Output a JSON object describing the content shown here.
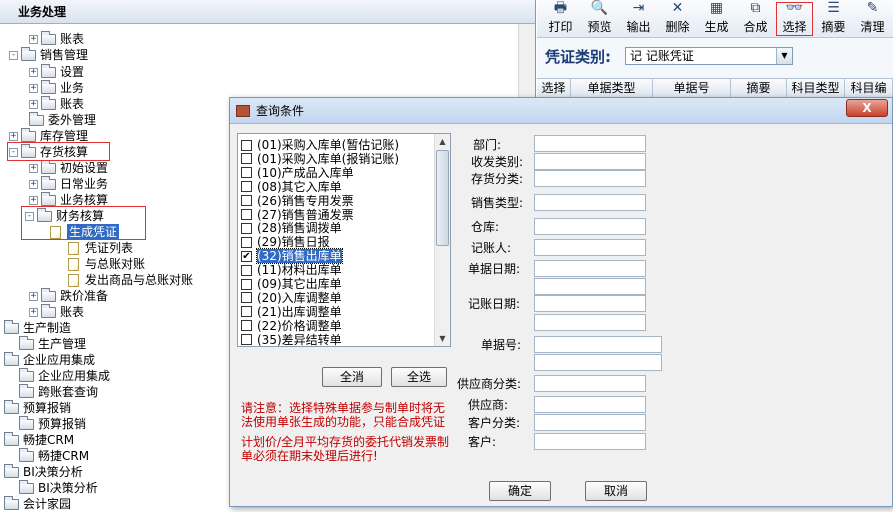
{
  "left_panel": {
    "title": "业务处理",
    "tree": [
      {
        "label": "账表",
        "expander": "+",
        "icon": "folder"
      },
      {
        "label": "销售管理",
        "expander": "-",
        "icon": "folder"
      },
      {
        "label": "设置",
        "expander": "+",
        "icon": "folder"
      },
      {
        "label": "业务",
        "expander": "+",
        "icon": "folder"
      },
      {
        "label": "账表",
        "expander": "+",
        "icon": "folder"
      },
      {
        "label": "委外管理",
        "expander": "",
        "icon": "folder"
      },
      {
        "label": "库存管理",
        "expander": "+",
        "icon": "folder"
      },
      {
        "label": "存货核算",
        "expander": "-",
        "icon": "folder"
      },
      {
        "label": "初始设置",
        "expander": "+",
        "icon": "folder"
      },
      {
        "label": "日常业务",
        "expander": "+",
        "icon": "folder"
      },
      {
        "label": "业务核算",
        "expander": "+",
        "icon": "folder"
      },
      {
        "label": "财务核算",
        "expander": "-",
        "icon": "folder"
      },
      {
        "label": "生成凭证",
        "expander": "",
        "icon": "doc"
      },
      {
        "label": "凭证列表",
        "expander": "",
        "icon": "doc"
      },
      {
        "label": "与总账对账",
        "expander": "",
        "icon": "doc"
      },
      {
        "label": "发出商品与总账对账",
        "expander": "",
        "icon": "doc"
      },
      {
        "label": "跌价准备",
        "expander": "+",
        "icon": "folder"
      },
      {
        "label": "账表",
        "expander": "+",
        "icon": "folder"
      },
      {
        "label": "生产制造",
        "expander": "",
        "icon": "folder"
      },
      {
        "label": "生产管理",
        "expander": "",
        "icon": "folder"
      },
      {
        "label": "企业应用集成",
        "expander": "",
        "icon": "folder"
      },
      {
        "label": "企业应用集成",
        "expander": "",
        "icon": "folder"
      },
      {
        "label": "跨账套查询",
        "expander": "",
        "icon": "folder"
      },
      {
        "label": "预算报销",
        "expander": "",
        "icon": "folder"
      },
      {
        "label": "预算报销",
        "expander": "",
        "icon": "folder"
      },
      {
        "label": "畅捷CRM",
        "expander": "",
        "icon": "folder"
      },
      {
        "label": "畅捷CRM",
        "expander": "",
        "icon": "folder"
      },
      {
        "label": "BI决策分析",
        "expander": "",
        "icon": "folder"
      },
      {
        "label": "BI决策分析",
        "expander": "",
        "icon": "folder"
      },
      {
        "label": "会计家园",
        "expander": "",
        "icon": "folder"
      }
    ]
  },
  "toolbar": {
    "buttons": [
      {
        "label": "打印",
        "icon": "printer-icon",
        "glyph": "🖶"
      },
      {
        "label": "预览",
        "icon": "preview-icon",
        "glyph": "🔍"
      },
      {
        "label": "输出",
        "icon": "export-icon",
        "glyph": "⇥"
      },
      {
        "label": "删除",
        "icon": "delete-icon",
        "glyph": "✕"
      },
      {
        "label": "生成",
        "icon": "generate-icon",
        "glyph": "▦"
      },
      {
        "label": "合成",
        "icon": "combine-icon",
        "glyph": "⧉"
      },
      {
        "label": "选择",
        "icon": "binoculars-icon",
        "glyph": "👓"
      },
      {
        "label": "摘要",
        "icon": "summary-icon",
        "glyph": "☰"
      },
      {
        "label": "清理",
        "icon": "clear-icon",
        "glyph": "✎"
      }
    ]
  },
  "voucher": {
    "label": "凭证类别:",
    "value": "记 记账凭证"
  },
  "grid": {
    "headers": [
      "选择",
      "单据类型",
      "单据号",
      "摘要",
      "科目类型",
      "科目编"
    ]
  },
  "dialog": {
    "title": "查询条件",
    "close_label": "X",
    "doc_types": [
      {
        "label": "(01)采购入库单(暂估记账)",
        "checked": false
      },
      {
        "label": "(01)采购入库单(报销记账)",
        "checked": false
      },
      {
        "label": "(10)产成品入库单",
        "checked": false
      },
      {
        "label": "(08)其它入库单",
        "checked": false
      },
      {
        "label": "(26)销售专用发票",
        "checked": false
      },
      {
        "label": "(27)销售普通发票",
        "checked": false
      },
      {
        "label": "(28)销售调拨单",
        "checked": false
      },
      {
        "label": "(29)销售日报",
        "checked": false
      },
      {
        "label": "(32)销售出库单",
        "checked": true
      },
      {
        "label": "(11)材料出库单",
        "checked": false
      },
      {
        "label": "(09)其它出库单",
        "checked": false
      },
      {
        "label": "(20)入库调整单",
        "checked": false
      },
      {
        "label": "(21)出库调整单",
        "checked": false
      },
      {
        "label": "(22)价格调整单",
        "checked": false
      },
      {
        "label": "(35)差异结转单",
        "checked": false
      }
    ],
    "clear_all_label": "全消",
    "select_all_label": "全选",
    "notice1": "请注意：选择特殊单据参与制单时将无法使用单张生成的功能，只能合成凭证",
    "notice2": "计划价/全月平均存货的委托代销发票制单必须在期末处理后进行!",
    "fields": {
      "dept": "部门:",
      "recv_send": "收发类别:",
      "inv_class": "存货分类:",
      "sale_type": "销售类型:",
      "warehouse": "仓库:",
      "bookkeeper": "记账人:",
      "doc_date": "单据日期:",
      "post_date": "记账日期:",
      "doc_no": "单据号:",
      "supplier_class": "供应商分类:",
      "supplier": "供应商:",
      "customer_class": "客户分类:",
      "customer": "客户:"
    },
    "ok_label": "确定",
    "cancel_label": "取消"
  }
}
